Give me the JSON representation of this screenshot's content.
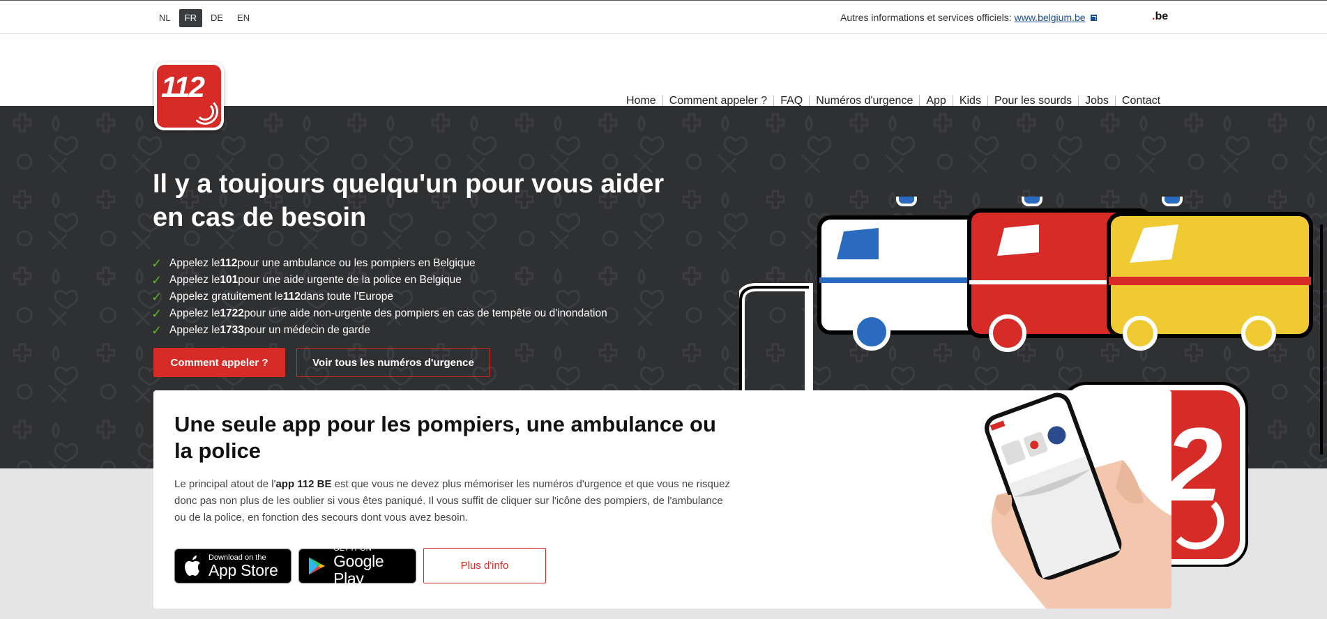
{
  "topbar": {
    "languages": [
      "NL",
      "FR",
      "DE",
      "EN"
    ],
    "active_language": "FR",
    "official_text": "Autres informations et services officiels:",
    "official_link": "www.belgium.be",
    "be_logo_text": "be"
  },
  "logo": {
    "text": "112"
  },
  "nav": {
    "items": [
      "Home",
      "Comment appeler ?",
      "FAQ",
      "Numéros d'urgence",
      "App",
      "Kids",
      "Pour les sourds",
      "Jobs",
      "Contact"
    ]
  },
  "hero": {
    "title": "Il y a toujours quelqu'un pour vous aider en cas de besoin",
    "list": [
      {
        "pre": "Appelez le ",
        "num": "112",
        "post": " pour une ambulance ou les pompiers en Belgique"
      },
      {
        "pre": "Appelez le ",
        "num": "101",
        "post": " pour une aide urgente de la police en Belgique"
      },
      {
        "pre": "Appelez gratuitement le ",
        "num": "112",
        "post": " dans toute l'Europe"
      },
      {
        "pre": "Appelez le ",
        "num": "1722",
        "post": " pour une aide non-urgente des pompiers en cas de tempête ou d'inondation"
      },
      {
        "pre": "Appelez le ",
        "num": "1733",
        "post": " pour un médecin de garde"
      }
    ],
    "btn_primary": "Comment appeler ?",
    "btn_secondary": "Voir tous les numéros d'urgence"
  },
  "app_card": {
    "title": "Une seule app pour les pompiers, une ambulance ou la police",
    "text_pre": "Le principal atout de l'",
    "text_bold": "app 112 BE",
    "text_post": " est que vous ne devez plus mémoriser les numéros d'urgence et que vous ne risquez donc pas non plus de les oublier si vous êtes paniqué. Il vous suffit de cliquer sur l'icône des pompiers, de l'ambulance ou de la police, en fonction des secours dont vous avez besoin.",
    "appstore_small": "Download on the",
    "appstore_big": "App Store",
    "googleplay_small": "GET IT ON",
    "googleplay_big": "Google Play",
    "more_button": "Plus d'info"
  },
  "colors": {
    "brand_red": "#d62b27",
    "hero_bg": "#2f3032",
    "check_green": "#5cb82c",
    "ambulance_blue": "#2a6bbf",
    "yellow": "#f0ca32"
  }
}
